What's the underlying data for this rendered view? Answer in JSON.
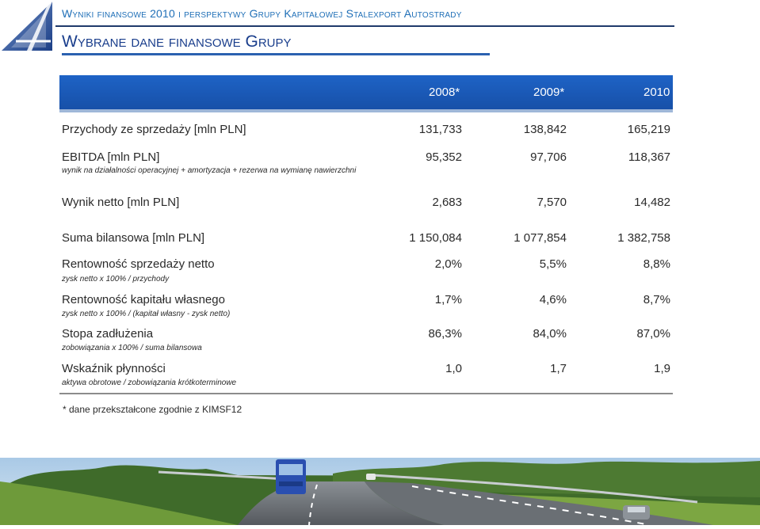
{
  "header": {
    "title": "Wyniki finansowe 2010 i perspektywy Grupy Kapitałowej Stalexport Autostrady",
    "section_title": "Wybrane dane finansowe Grupy"
  },
  "table": {
    "columns": [
      "2008*",
      "2009*",
      "2010"
    ],
    "rows": [
      {
        "label": "Przychody ze sprzedaży [mln PLN]",
        "sub": "",
        "values": [
          "131,733",
          "138,842",
          "165,219"
        ]
      },
      {
        "label": "EBITDA [mln PLN]",
        "sub": "wynik na działalności operacyjnej + amortyzacja + rezerwa na wymianę nawierzchni",
        "values": [
          "95,352",
          "97,706",
          "118,367"
        ]
      },
      {
        "label": "Wynik netto [mln PLN]",
        "sub": "",
        "values": [
          "2,683",
          "7,570",
          "14,482"
        ]
      },
      {
        "label": "Suma bilansowa [mln PLN]",
        "sub": "",
        "values": [
          "1 150,084",
          "1 077,854",
          "1 382,758"
        ]
      },
      {
        "label": "Rentowność sprzedaży netto",
        "sub": "zysk netto x 100% / przychody",
        "values": [
          "2,0%",
          "5,5%",
          "8,8%"
        ]
      },
      {
        "label": "Rentowność kapitału własnego",
        "sub": "zysk netto x 100% / (kapitał własny - zysk netto)",
        "values": [
          "1,7%",
          "4,6%",
          "8,7%"
        ]
      },
      {
        "label": "Stopa zadłużenia",
        "sub": "zobowiązania x 100% / suma bilansowa",
        "values": [
          "86,3%",
          "84,0%",
          "87,0%"
        ]
      },
      {
        "label": "Wskaźnik płynności",
        "sub": "aktywa obrotowe / zobowiązania krótkoterminowe",
        "values": [
          "1,0",
          "1,7",
          "1,9"
        ]
      }
    ]
  },
  "footnote": "* dane przekształcone zgodnie z KIMSF12",
  "colors": {
    "header_bar": "#1e63c6",
    "title_text": "#1a3e8c",
    "accent": "#1f6fb7"
  },
  "icons": {
    "logo": "stalexport-logo",
    "photo": "highway-photo"
  }
}
